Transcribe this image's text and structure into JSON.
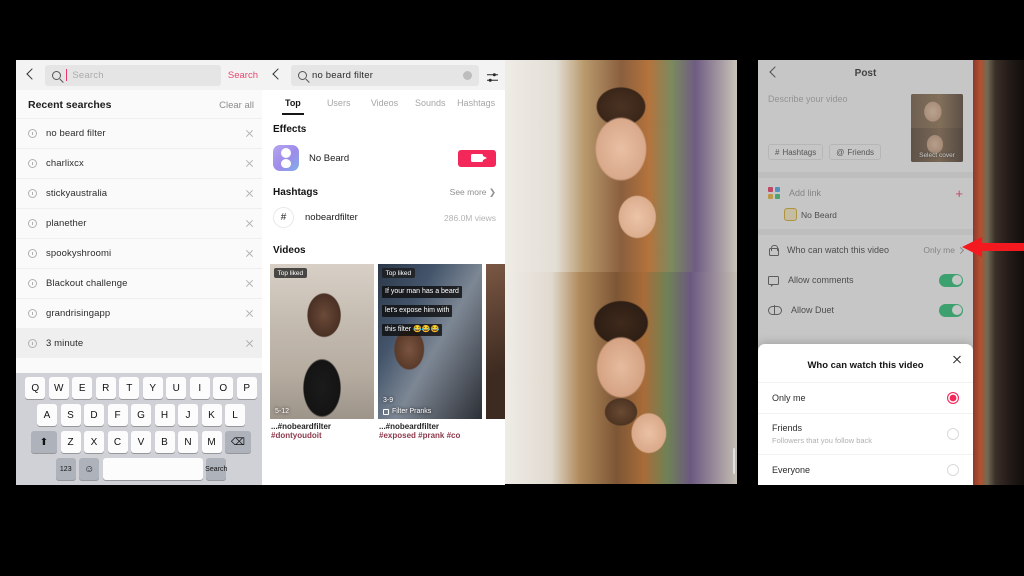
{
  "panel_search": {
    "back_icon": "back-chevron-icon",
    "search_input": {
      "placeholder": "Search",
      "value": ""
    },
    "search_button": "Search",
    "recent_title": "Recent searches",
    "clear_all": "Clear all",
    "recent_items": [
      {
        "label": "no beard filter"
      },
      {
        "label": "charlixcx"
      },
      {
        "label": "stickyaustralia"
      },
      {
        "label": "planether"
      },
      {
        "label": "spookyshroomi"
      },
      {
        "label": "Blackout challenge"
      },
      {
        "label": "grandrisingapp"
      },
      {
        "label": "3 minute"
      }
    ],
    "keyboard": {
      "row1": [
        "Q",
        "W",
        "E",
        "R",
        "T",
        "Y",
        "U",
        "I",
        "O",
        "P"
      ],
      "row2": [
        "A",
        "S",
        "D",
        "F",
        "G",
        "H",
        "J",
        "K",
        "L"
      ],
      "row3": [
        "⬆",
        "Z",
        "X",
        "C",
        "V",
        "B",
        "N",
        "M",
        "⌫"
      ],
      "row4": [
        "123",
        "☺",
        "space",
        "Search"
      ]
    }
  },
  "panel_results": {
    "back_icon": "back-chevron-icon",
    "search_value": "no beard filter",
    "clear_icon": "clear-circle-icon",
    "filter_icon": "tune-sliders-icon",
    "tabs": [
      {
        "label": "Top",
        "active": true
      },
      {
        "label": "Users",
        "active": false
      },
      {
        "label": "Videos",
        "active": false
      },
      {
        "label": "Sounds",
        "active": false
      },
      {
        "label": "Hashtags",
        "active": false
      }
    ],
    "effects_title": "Effects",
    "effect": {
      "name": "No Beard",
      "record_icon": "video-camera-icon"
    },
    "hashtags_title": "Hashtags",
    "see_more": "See more ❯",
    "hashtag": {
      "symbol": "#",
      "name": "nobeardfilter",
      "views": "286.0M views"
    },
    "videos_title": "Videos",
    "videos": [
      {
        "badge": "Top liked",
        "date": "5-12",
        "caption_line1": "...#nobeardfilter",
        "caption_line2": "#dontyoudoit",
        "overlay": []
      },
      {
        "badge": "Top liked",
        "date": "3-9",
        "sound": "Filter Pranks",
        "caption_line1": "...#nobeardfilter",
        "caption_line2": "#exposed #prank #co",
        "overlay": [
          "If your man has a beard",
          "let's expose him with",
          "this filter 😂😂😂"
        ]
      }
    ]
  },
  "panel_preview": {
    "description": "video preview frames of a man with a beard filter"
  },
  "panel_post": {
    "back_icon": "back-chevron-icon",
    "title": "Post",
    "description_placeholder": "Describe your video",
    "chips": [
      {
        "icon": "hash-icon",
        "label": "Hashtags"
      },
      {
        "icon": "at-icon",
        "label": "Friends"
      }
    ],
    "cover_label": "Select cover",
    "add_link": {
      "label": "Add link",
      "plus": "+"
    },
    "effect_chip": "No Beard",
    "rows": [
      {
        "icon": "lock-icon",
        "label": "Who can watch this video",
        "value": "Only me",
        "type": "value"
      },
      {
        "icon": "comment-icon",
        "label": "Allow comments",
        "value": "on",
        "type": "toggle"
      },
      {
        "icon": "duet-icon",
        "label": "Allow Duet",
        "value": "on",
        "type": "toggle"
      }
    ]
  },
  "sheet": {
    "title": "Who can watch this video",
    "close_icon": "close-icon",
    "options": [
      {
        "label": "Only me",
        "sub": "",
        "selected": true
      },
      {
        "label": "Friends",
        "sub": "Followers that you follow back",
        "selected": false
      },
      {
        "label": "Everyone",
        "sub": "",
        "selected": false
      }
    ]
  },
  "annotation": {
    "arrow_color": "#f4181f",
    "arrow_direction": "left"
  }
}
